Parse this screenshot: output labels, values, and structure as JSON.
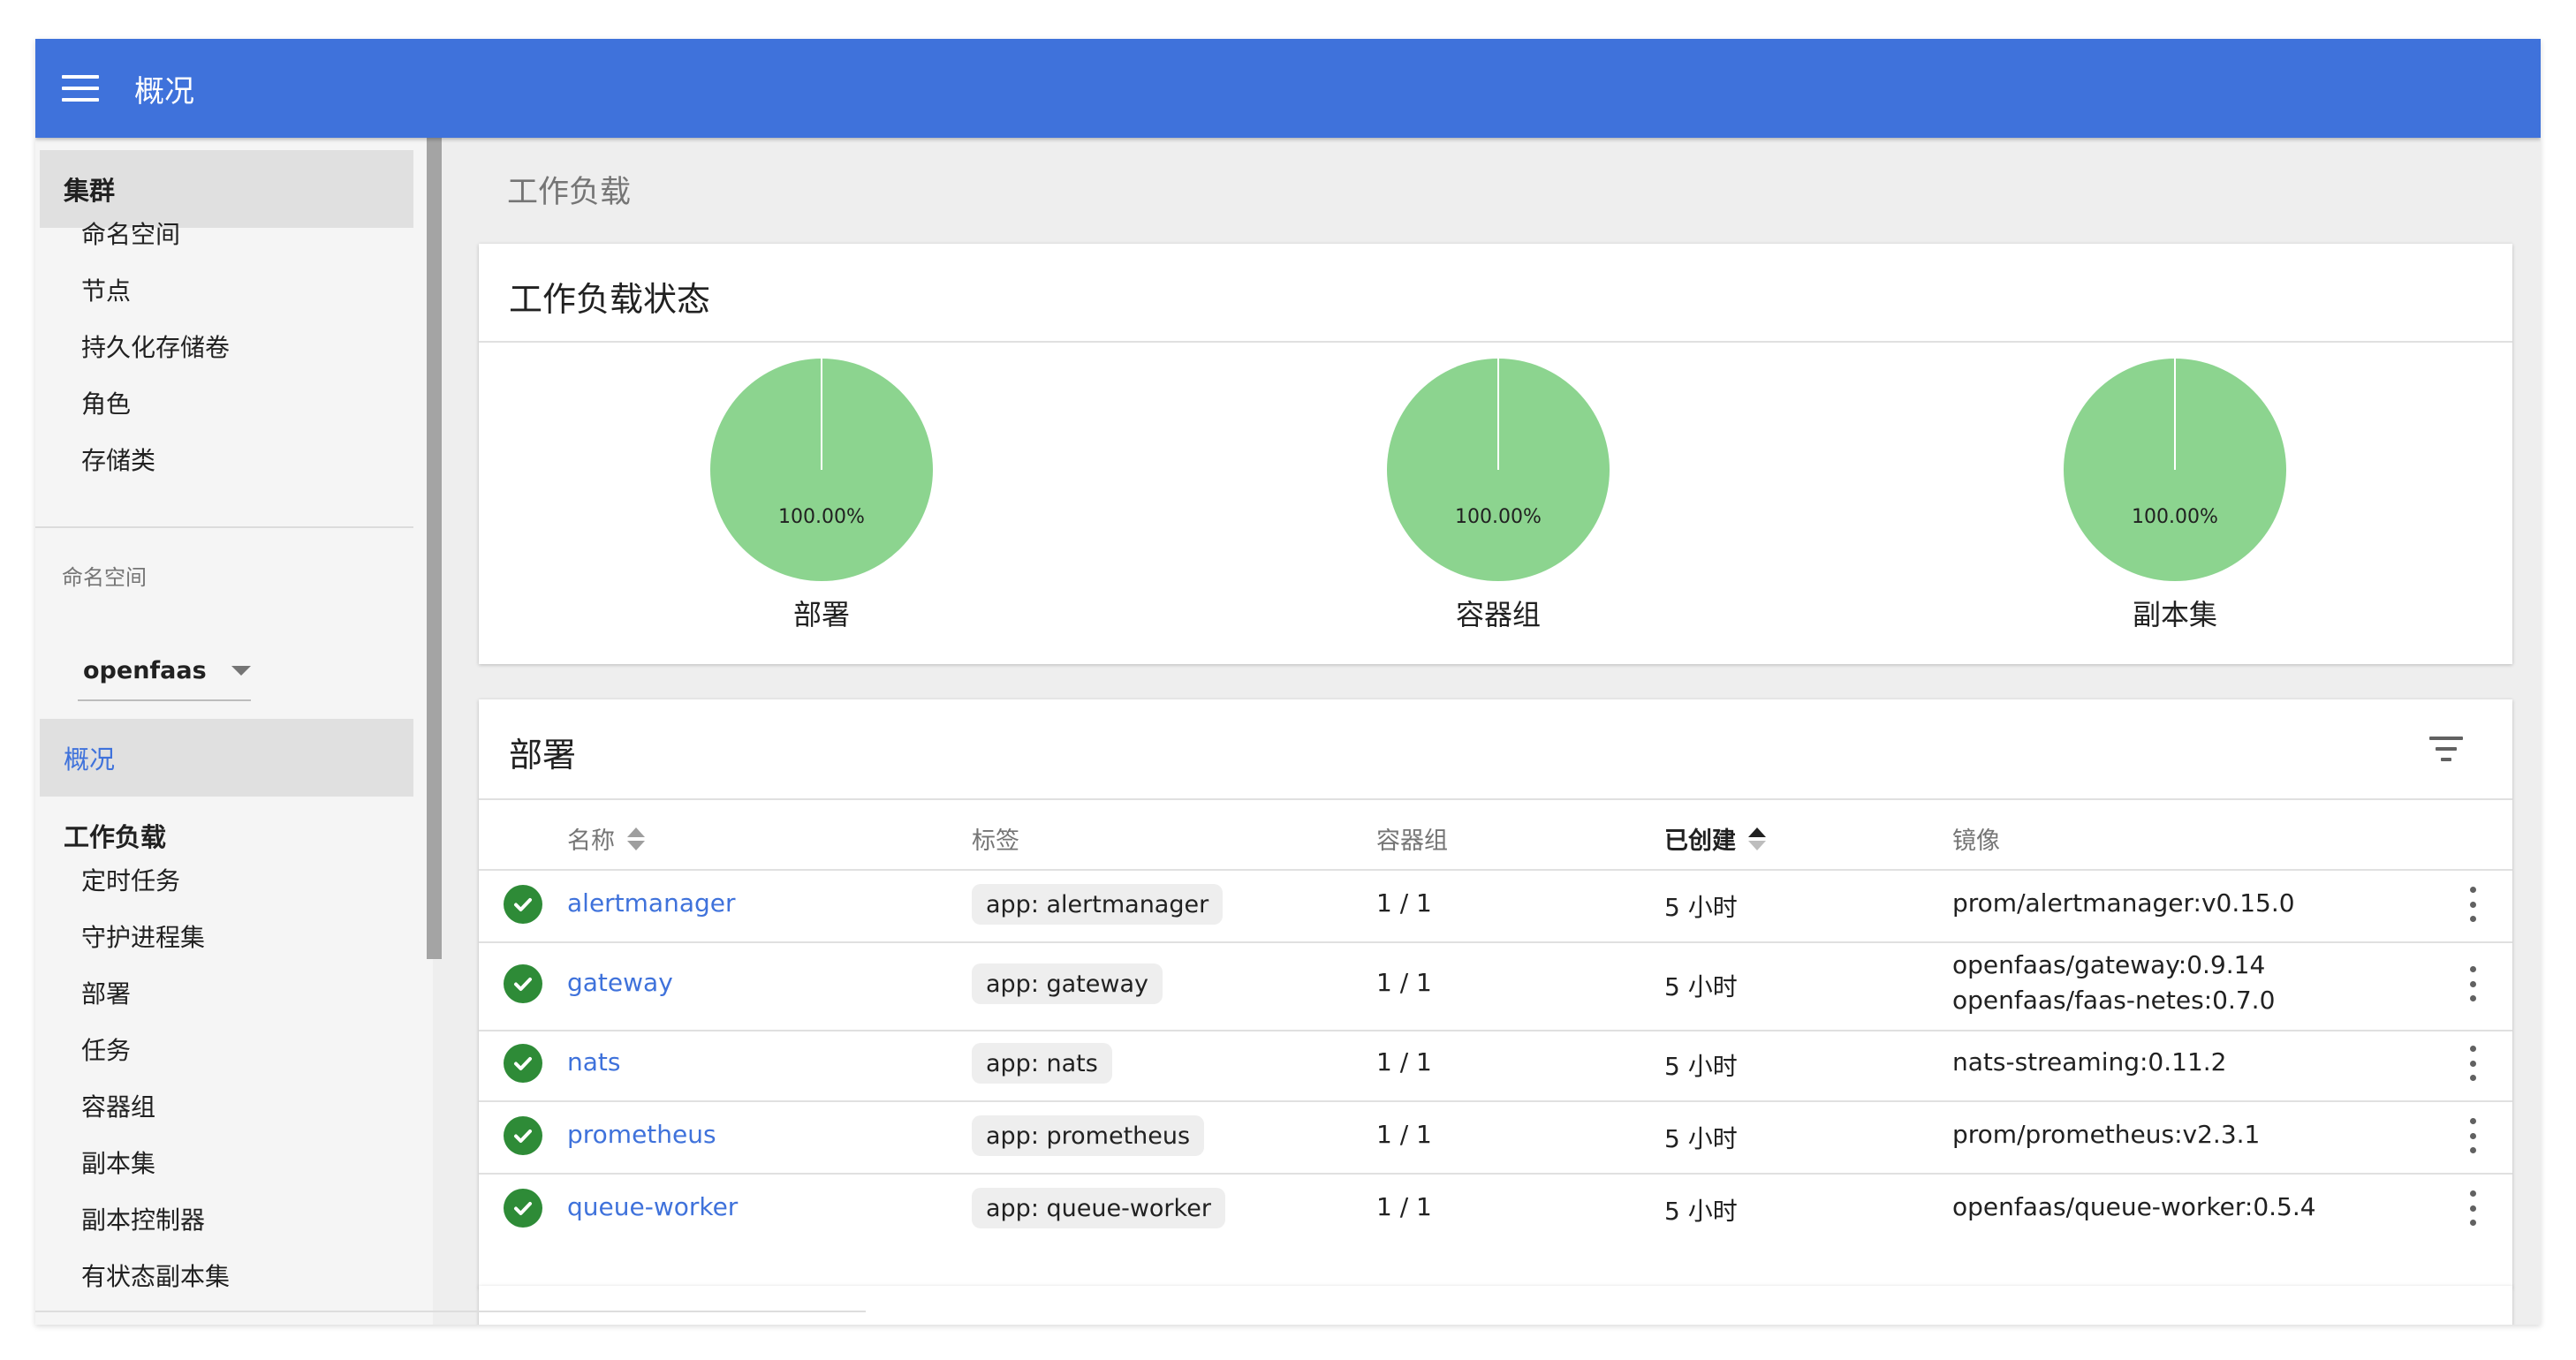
{
  "topbar": {
    "title": "概况"
  },
  "sidebar": {
    "cluster": {
      "title": "集群",
      "items": [
        "命名空间",
        "节点",
        "持久化存储卷",
        "角色",
        "存储类"
      ]
    },
    "namespace": {
      "label": "命名空间",
      "value": "openfaas"
    },
    "overview": "概况",
    "workloads": {
      "title": "工作负载",
      "items": [
        "定时任务",
        "守护进程集",
        "部署",
        "任务",
        "容器组",
        "副本集",
        "副本控制器",
        "有状态副本集"
      ]
    }
  },
  "content": {
    "title": "工作负载"
  },
  "status_card": {
    "title": "工作负载状态",
    "charts": [
      {
        "label": "部署",
        "percent_text": "100.00%",
        "value": 100
      },
      {
        "label": "容器组",
        "percent_text": "100.00%",
        "value": 100
      },
      {
        "label": "副本集",
        "percent_text": "100.00%",
        "value": 100
      }
    ],
    "pie_color": "#8cd48f"
  },
  "deployments": {
    "title": "部署",
    "columns": {
      "name": "名称",
      "labels": "标签",
      "pods": "容器组",
      "created": "已创建",
      "images": "镜像"
    },
    "rows": [
      {
        "name": "alertmanager",
        "label": "app: alertmanager",
        "pods": "1 / 1",
        "created": "5 小时",
        "images": [
          "prom/alertmanager:v0.15.0"
        ]
      },
      {
        "name": "gateway",
        "label": "app: gateway",
        "pods": "1 / 1",
        "created": "5 小时",
        "images": [
          "openfaas/gateway:0.9.14",
          "openfaas/faas-netes:0.7.0"
        ]
      },
      {
        "name": "nats",
        "label": "app: nats",
        "pods": "1 / 1",
        "created": "5 小时",
        "images": [
          "nats-streaming:0.11.2"
        ]
      },
      {
        "name": "prometheus",
        "label": "app: prometheus",
        "pods": "1 / 1",
        "created": "5 小时",
        "images": [
          "prom/prometheus:v2.3.1"
        ]
      },
      {
        "name": "queue-worker",
        "label": "app: queue-worker",
        "pods": "1 / 1",
        "created": "5 小时",
        "images": [
          "openfaas/queue-worker:0.5.4"
        ]
      }
    ]
  },
  "colors": {
    "accent": "#3f72db",
    "status_ok": "#2e8b37"
  }
}
